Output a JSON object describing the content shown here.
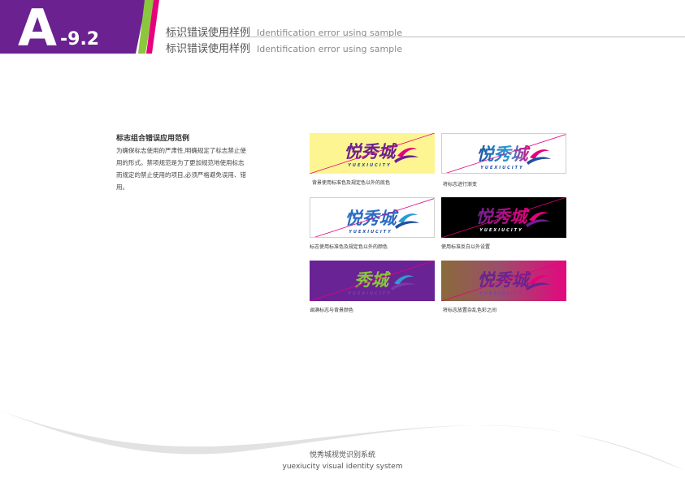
{
  "header": {
    "section_letter": "A",
    "section_number": "-9.2",
    "title_zh": "标识错误使用样例",
    "title_en": "Identification error using sample"
  },
  "description": {
    "heading": "标志组合错误应用范例",
    "body": "为确保标志使用的严肃性,明确规定了标志禁止使用的形式。禁项规范是为了更加规范地使用标志而规定的禁止使用的项目,必须严格避免误用、错用。"
  },
  "logo": {
    "name_cn": "悦秀城",
    "name_partial": "秀城",
    "wordmark": "YUEXIUCITY"
  },
  "samples": [
    {
      "caption": "背景使用标准色及规定色以外的底色",
      "background": "#fdf592"
    },
    {
      "caption": "将标志进行渐变",
      "background": "#ffffff"
    },
    {
      "caption": "标志使用标准色及规定色以外的颜色",
      "background": "#ffffff"
    },
    {
      "caption": "使用标准反白以外设置",
      "background": "#000000"
    },
    {
      "caption": "调满标志与背景颜色",
      "background": "#6a2394"
    },
    {
      "caption": "将标志放置杂乱色彩之间",
      "background": "#e3087f"
    }
  ],
  "colors": {
    "brand_purple": "#6b2290",
    "brand_green": "#8cc63f",
    "brand_magenta": "#e6007e",
    "brand_blue": "#1f4fa0",
    "error_line": "#e6007e"
  },
  "footer": {
    "name_zh": "悦秀城视觉识别系统",
    "name_en": "yuexiucity visual identity system"
  }
}
